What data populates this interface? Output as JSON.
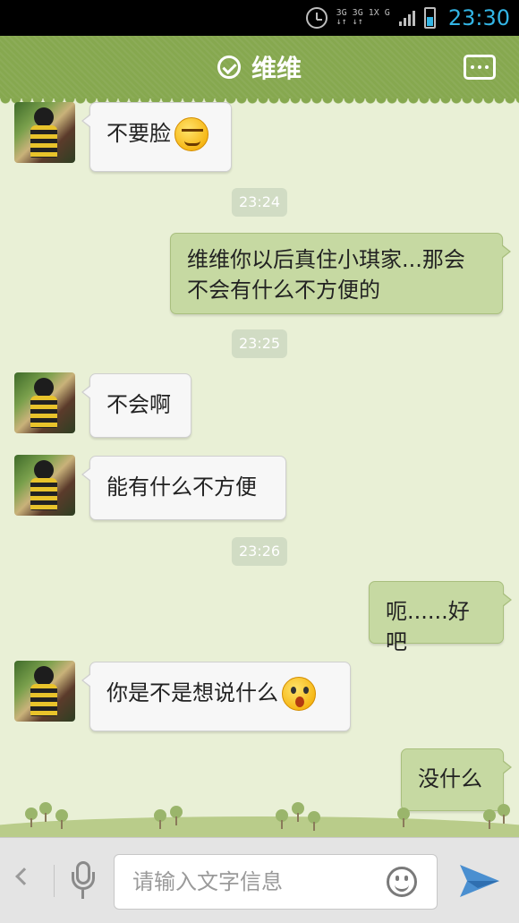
{
  "status_bar": {
    "network_top": "3G 3G 1X G",
    "network_bottom": "↓↑ ↓↑",
    "time": "23:30"
  },
  "header": {
    "title": "维维",
    "online_icon": "check-circle-icon",
    "menu_icon": "more-icon"
  },
  "messages": [
    {
      "side": "left",
      "text": "不要脸",
      "emoji": "smirk"
    },
    {
      "type": "time",
      "text": "23:24"
    },
    {
      "side": "right",
      "text": "维维你以后真住小琪家...那会不会有什么不方便的"
    },
    {
      "type": "time",
      "text": "23:25"
    },
    {
      "side": "left",
      "text": "不会啊"
    },
    {
      "side": "left",
      "text": "能有什么不方便"
    },
    {
      "type": "time",
      "text": "23:26"
    },
    {
      "side": "right",
      "text": "呃......好吧"
    },
    {
      "side": "left",
      "text": "你是不是想说什么",
      "emoji": "shock"
    },
    {
      "side": "right",
      "text": "没什么"
    }
  ],
  "input": {
    "placeholder": "请输入文字信息",
    "value": ""
  },
  "colors": {
    "header": "#86a84f",
    "background": "#e9f0d6",
    "bubble_right": "#c6d9a2",
    "bubble_left": "#f7f7f7",
    "clock": "#33b5e5",
    "send": "#4a8fd0"
  }
}
